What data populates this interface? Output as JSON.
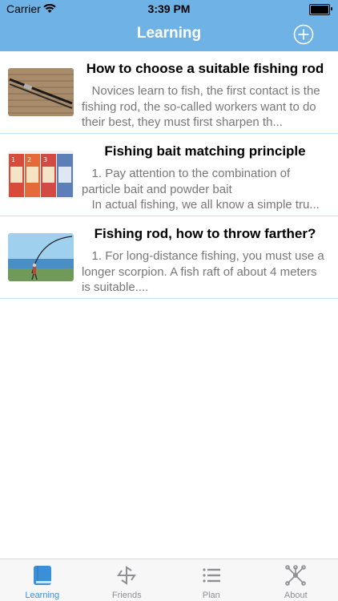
{
  "status": {
    "carrier": "Carrier",
    "time": "3:39 PM"
  },
  "nav": {
    "title": "Learning"
  },
  "articles": [
    {
      "title": "How to choose a suitable fishing rod",
      "excerpt": "   Novices learn to fish, the first contact is the fishing rod, the so-called workers want to do their best, they must first sharpen th..."
    },
    {
      "title": "Fishing bait matching principle",
      "excerpt": "   1. Pay attention to the combination of particle bait and powder bait\n   In actual fishing, we all know a simple tru..."
    },
    {
      "title": "Fishing rod, how to throw farther?",
      "excerpt": "   1. For long-distance fishing, you must use a longer scorpion. A fish raft of about 4 meters is suitable...."
    }
  ],
  "tabs": [
    {
      "label": "Learning",
      "icon": "book-icon",
      "active": true
    },
    {
      "label": "Friends",
      "icon": "pinwheel-icon",
      "active": false
    },
    {
      "label": "Plan",
      "icon": "list-icon",
      "active": false
    },
    {
      "label": "About",
      "icon": "network-icon",
      "active": false
    }
  ],
  "colors": {
    "accent": "#6fb3e6",
    "tab_active": "#3a8fd6",
    "tab_inactive": "#8e8e93"
  }
}
